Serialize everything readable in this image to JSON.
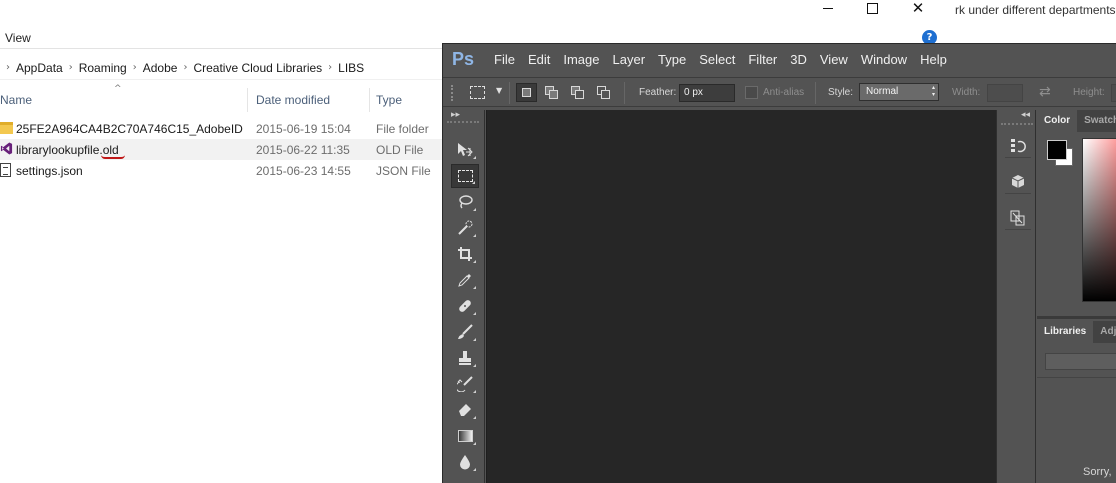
{
  "background_window": {
    "partial_text": "rk under different departments sc"
  },
  "explorer": {
    "window_controls": {
      "minimize": "",
      "maximize": "",
      "close": "✕"
    },
    "menu": {
      "view_label": "View"
    },
    "help_label": "?",
    "breadcrumb": [
      "AppData",
      "Roaming",
      "Adobe",
      "Creative Cloud Libraries",
      "LIBS"
    ],
    "breadcrumb_separator": "›",
    "columns": {
      "name": "Name",
      "date_modified": "Date modified",
      "type": "Type"
    },
    "sort_indicator": "^",
    "files": [
      {
        "name": "25FE2A964CA4B2C70A746C15_AdobeID",
        "date": "2015-06-19 15:04",
        "type": "File folder",
        "icon": "folder-icon"
      },
      {
        "name": "librarylookupfile.old",
        "date": "2015-06-22 11:35",
        "type": "OLD File",
        "icon": "visual-studio-icon",
        "selected": true
      },
      {
        "name": "settings.json",
        "date": "2015-06-23 14:55",
        "type": "JSON File",
        "icon": "json-file-icon"
      }
    ]
  },
  "photoshop": {
    "logo": "Ps",
    "menu": [
      "File",
      "Edit",
      "Image",
      "Layer",
      "Type",
      "Select",
      "Filter",
      "3D",
      "View",
      "Window",
      "Help"
    ],
    "options": {
      "feather_label": "Feather:",
      "feather_value": "0 px",
      "anti_alias_label": "Anti-alias",
      "style_label": "Style:",
      "style_value": "Normal",
      "width_label": "Width:",
      "height_label": "Height:"
    },
    "tools": [
      "move-tool",
      "rectangular-marquee-tool",
      "lasso-tool",
      "quick-selection-tool",
      "crop-tool",
      "eyedropper-tool",
      "spot-healing-brush-tool",
      "brush-tool",
      "clone-stamp-tool",
      "history-brush-tool",
      "eraser-tool",
      "gradient-tool",
      "blur-tool"
    ],
    "active_tool": "rectangular-marquee-tool",
    "panels": {
      "top_tabs": [
        "Color",
        "Swatch"
      ],
      "bottom_tabs": [
        "Libraries",
        "Adj"
      ],
      "libraries_text": "Sorry,"
    },
    "colors": {
      "foreground": "#000000",
      "background": "#ffffff",
      "canvas": "#262626",
      "chrome": "#535353"
    }
  }
}
